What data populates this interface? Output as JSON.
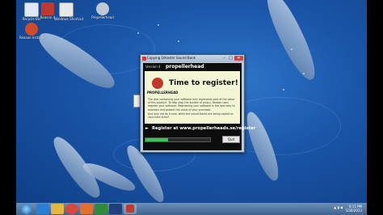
{
  "desktop": {
    "icons": [
      {
        "label": "Recycle Bin",
        "icon": "recycle-bin-icon"
      },
      {
        "label": "Reason 4",
        "icon": "reason-app-icon"
      },
      {
        "label": "Windows Shortcut",
        "icon": "shortcut-icon"
      },
      {
        "label": "Propellerhead",
        "icon": "propellerhead-icon"
      },
      {
        "label": "Reason Installer",
        "icon": "installer-icon"
      }
    ]
  },
  "window": {
    "title": "Copying Orkester Sound Bank",
    "minimize_glyph": "–",
    "maximize_glyph": "□",
    "close_glyph": "✕",
    "version_label": "Version 4",
    "brand": "propellerhead",
    "logo_text": "PROPELLERHEAD",
    "headline": "Time to register!",
    "body_1": "The disk containing your software only represents part of the value of this product. To help stop the burden of piracy, Reason uses register your software. Registering your software is the best way to maintain and protect the value of your purchase.",
    "body_2": "And why not do it now, while the sound banks are being copied to your hard drive?",
    "register_text": "Register at www.propellerheads.se/register",
    "progress_fraction": 0.35,
    "quit_label": "Quit"
  },
  "taskbar": {
    "apps": [
      "internet-explorer-icon",
      "file-explorer-icon",
      "chrome-icon",
      "media-player-icon",
      "wmp-icon",
      "photoshop-icon",
      "reason-icon"
    ],
    "time": "6:11 PM",
    "date": "5/30/2013"
  },
  "colors": {
    "accent_red": "#c0392b",
    "progress_green": "#3fbf5a",
    "panel_bg": "#f2f6d4"
  }
}
